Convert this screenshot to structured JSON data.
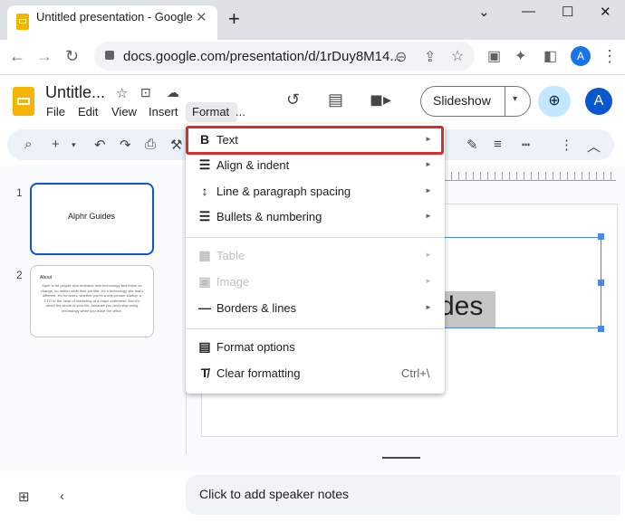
{
  "browser": {
    "tab_title": "Untitled presentation - Google Sl",
    "new_tab": "+",
    "url": "docs.google.com/presentation/d/1rDuy8M14...",
    "profile_initial": "A"
  },
  "doc": {
    "title": "Untitle...",
    "menus": [
      "File",
      "Edit",
      "View",
      "Insert",
      "Format",
      "..."
    ],
    "slideshow_label": "Slideshow",
    "account_initial": "A"
  },
  "filmstrip": {
    "slide1_num": "1",
    "slide1_text": "Alphr Guides",
    "slide2_num": "2",
    "slide2_title": "About",
    "slide2_body": "Alphr is for people who embrace new technology and thrive on change, no matter what their job title. It's a technology site that's different. It's for doers, whether you're a one-person startup, a CTO or the head of marketing at a major enterprise. And it's about the whole of your life, because you don't stop using technology when you leave the office."
  },
  "canvas": {
    "visible_text": "des"
  },
  "format_menu": {
    "items": [
      {
        "label": "Text",
        "icon": "bold-icon",
        "glyph": "B",
        "submenu": true,
        "disabled": false
      },
      {
        "label": "Align & indent",
        "icon": "align-icon",
        "glyph": "☰",
        "submenu": true,
        "disabled": false
      },
      {
        "label": "Line & paragraph spacing",
        "icon": "line-spacing-icon",
        "glyph": "↕",
        "submenu": true,
        "disabled": false
      },
      {
        "label": "Bullets & numbering",
        "icon": "bullets-icon",
        "glyph": "☰",
        "submenu": true,
        "disabled": false
      },
      {
        "label": "Table",
        "icon": "table-icon",
        "glyph": "▦",
        "submenu": true,
        "disabled": true
      },
      {
        "label": "Image",
        "icon": "image-icon",
        "glyph": "▣",
        "submenu": true,
        "disabled": true
      },
      {
        "label": "Borders & lines",
        "icon": "borders-icon",
        "glyph": "—",
        "submenu": true,
        "disabled": false
      },
      {
        "label": "Format options",
        "icon": "format-options-icon",
        "glyph": "▤",
        "submenu": false,
        "disabled": false
      },
      {
        "label": "Clear formatting",
        "icon": "clear-format-icon",
        "glyph": "T̸",
        "submenu": false,
        "disabled": false
      }
    ],
    "clear_shortcut": "Ctrl+\\",
    "highlight_color": "#d32f2f"
  },
  "notes": {
    "placeholder": "Click to add speaker notes"
  }
}
